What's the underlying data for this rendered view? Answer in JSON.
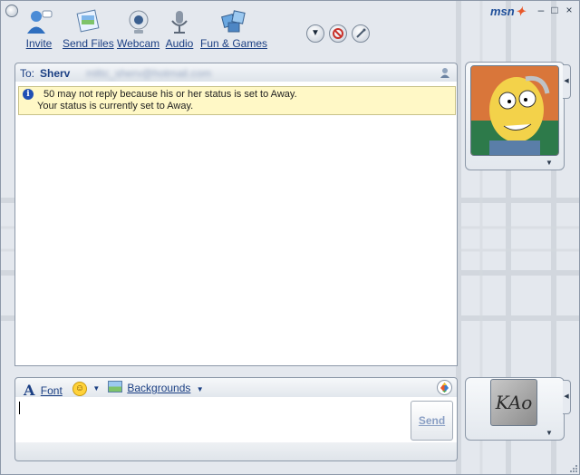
{
  "window": {
    "logo": "msn",
    "controls": [
      "–",
      "□",
      "×"
    ]
  },
  "toolbar": {
    "items": [
      {
        "label": "Invite",
        "icon": "invite-icon"
      },
      {
        "label": "Send Files",
        "icon": "send-files-icon"
      },
      {
        "label": "Webcam",
        "icon": "webcam-icon"
      },
      {
        "label": "Audio",
        "icon": "audio-icon"
      },
      {
        "label": "Fun & Games",
        "icon": "fun-games-icon"
      }
    ],
    "round_buttons": [
      "menu-dropdown-icon",
      "block-icon",
      "options-icon"
    ]
  },
  "conversation": {
    "to_label": "To:",
    "to_name": "Sherv",
    "to_email": "mlttc_sherv@hotmail.com",
    "notice_line1": "50 may not reply because his or her status is set to Away.",
    "notice_line2": "Your status is currently set to Away."
  },
  "input_toolbar": {
    "font_label": "Font",
    "backgrounds_label": "Backgrounds"
  },
  "send_label": "Send",
  "my_avatar_text": "KAo",
  "colors": {
    "accent": "#1b3f83",
    "notice_bg": "#fff8c6",
    "frame": "#e4e8ee"
  }
}
